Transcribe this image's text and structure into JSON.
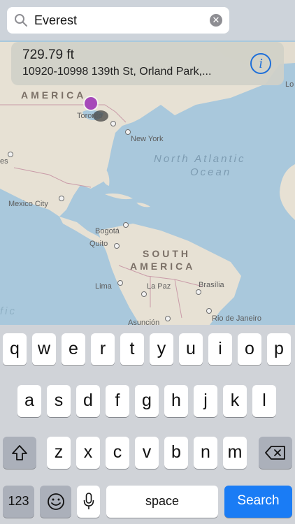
{
  "search": {
    "value": "Everest",
    "clear_icon": "clear-circle-icon",
    "search_icon": "magnifier-icon"
  },
  "callout": {
    "elevation": "729.79 ft",
    "address": "10920-10998 139th St, Orland Park,...",
    "info_icon": "info-circle-icon"
  },
  "map_labels": {
    "north_america": "AMERICA",
    "toronto": "Toronto",
    "new_york": "New York",
    "north_atlantic_1": "North Atlantic",
    "north_atlantic_2": "Ocean",
    "mexico_city": "Mexico City",
    "bogota": "Bogotá",
    "quito": "Quito",
    "south_america_1": "SOUTH",
    "south_america_2": "AMERICA",
    "lima": "Lima",
    "la_paz": "La Paz",
    "brasilia": "Brasília",
    "rio": "Rio de Janeiro",
    "asuncion": "Asunción",
    "lo": "Lo",
    "es": "es",
    "fic": "fic"
  },
  "keyboard": {
    "row1": [
      "q",
      "w",
      "e",
      "r",
      "t",
      "y",
      "u",
      "i",
      "o",
      "p"
    ],
    "row2": [
      "a",
      "s",
      "d",
      "f",
      "g",
      "h",
      "j",
      "k",
      "l"
    ],
    "row3": [
      "z",
      "x",
      "c",
      "v",
      "b",
      "n",
      "m"
    ],
    "numbers_label": "123",
    "space_label": "space",
    "search_label": "Search",
    "shift_icon": "shift-icon",
    "delete_icon": "backspace-icon",
    "emoji_icon": "emoji-icon",
    "mic_icon": "microphone-icon"
  },
  "colors": {
    "accent": "#1a7cf5",
    "pin": "#a649b9",
    "info": "#1e6fd9"
  }
}
